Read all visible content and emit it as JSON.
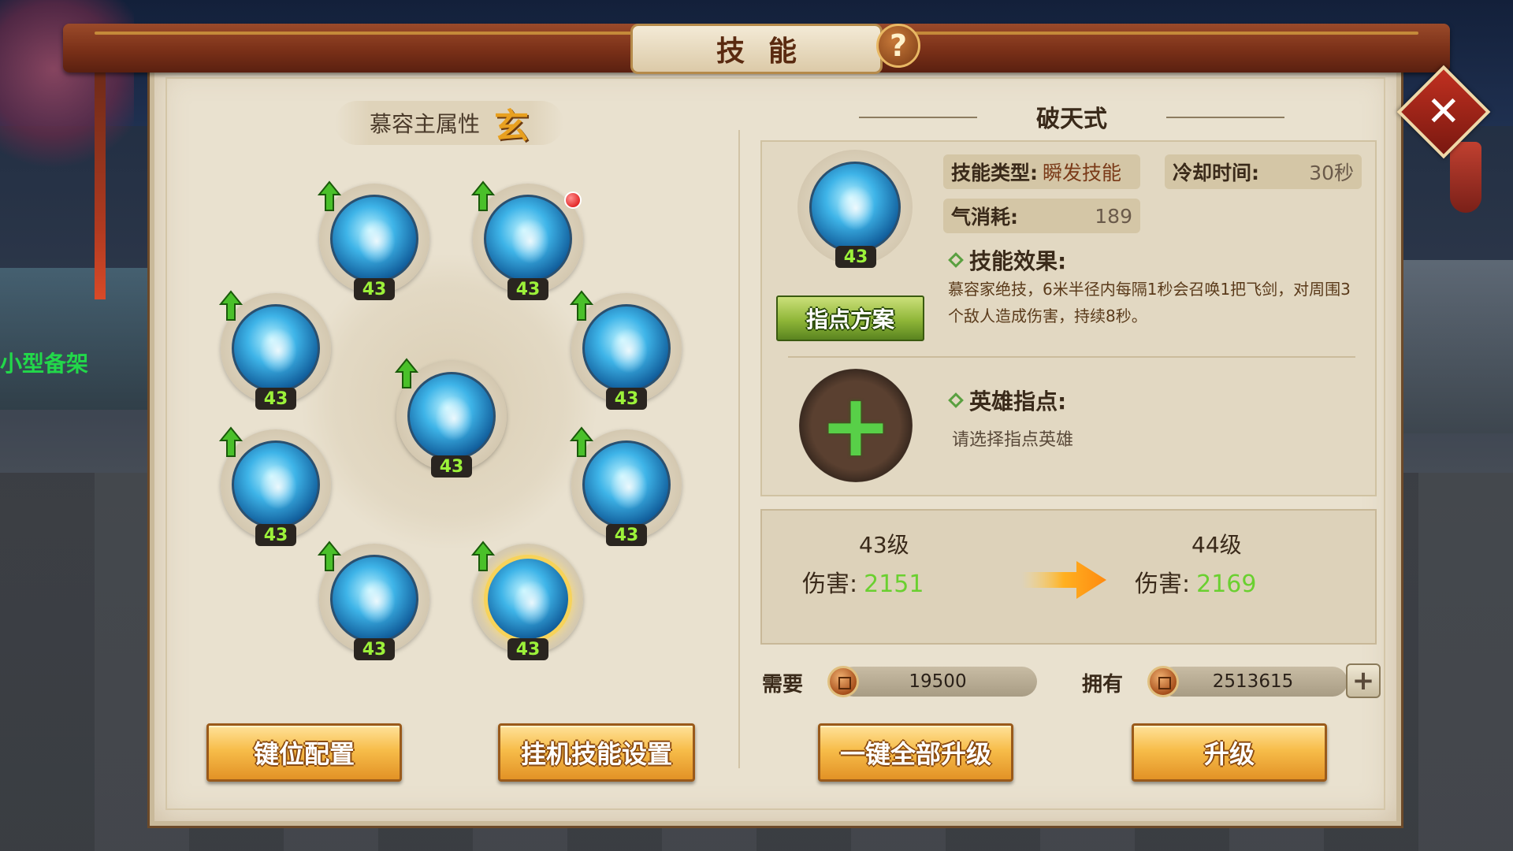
{
  "window": {
    "title": "技能"
  },
  "background": {
    "npc_name": "小型备架"
  },
  "left": {
    "attribute_label": "慕容主属性",
    "attribute_value": "玄",
    "skills": [
      {
        "id": 1,
        "level": "43",
        "upgradable": true,
        "selected": false,
        "alert": false
      },
      {
        "id": 2,
        "level": "43",
        "upgradable": true,
        "selected": false,
        "alert": true
      },
      {
        "id": 3,
        "level": "43",
        "upgradable": true,
        "selected": false,
        "alert": false
      },
      {
        "id": 4,
        "level": "43",
        "upgradable": true,
        "selected": false,
        "alert": false
      },
      {
        "id": 5,
        "level": "43",
        "upgradable": true,
        "selected": false,
        "alert": false
      },
      {
        "id": 6,
        "level": "43",
        "upgradable": true,
        "selected": false,
        "alert": false
      },
      {
        "id": 7,
        "level": "43",
        "upgradable": true,
        "selected": false,
        "alert": false
      },
      {
        "id": 8,
        "level": "43",
        "upgradable": true,
        "selected": false,
        "alert": false
      },
      {
        "id": 9,
        "level": "43",
        "upgradable": true,
        "selected": true,
        "alert": false
      }
    ],
    "key_config_label": "键位配置",
    "auto_skill_label": "挂机技能设置"
  },
  "right": {
    "skill_name": "破天式",
    "skill_level": "43",
    "type_key": "技能类型:",
    "type_value": "瞬发技能",
    "cooldown_key": "冷却时间:",
    "cooldown_value": "30秒",
    "qi_key": "气消耗:",
    "qi_value": "189",
    "effect_title": "技能效果:",
    "effect_text": "慕容家绝技，6米半径内每隔1秒会召唤1把飞剑，对周围3个敌人造成伤害，持续8秒。",
    "guide_button": "指点方案",
    "hero_title": "英雄指点:",
    "hero_hint": "请选择指点英雄",
    "current_level": "43级",
    "next_level": "44级",
    "damage_label": "伤害:",
    "current_damage": "2151",
    "next_damage": "2169",
    "need_label": "需要",
    "need_value": "19500",
    "own_label": "拥有",
    "own_value": "2513615",
    "upgrade_all_label": "一键全部升级",
    "upgrade_label": "升级"
  },
  "colors": {
    "panel_bg": "#e9e1cf",
    "level_green": "#9cf23a",
    "damage_green": "#6ad030",
    "button_gold": "#f7bd4a",
    "button_green": "#8fb638"
  }
}
